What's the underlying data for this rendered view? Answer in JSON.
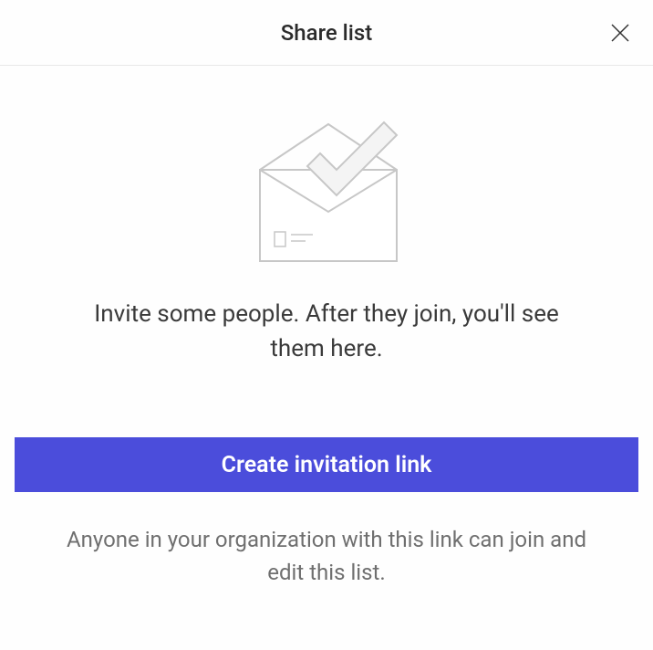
{
  "dialog": {
    "title": "Share list",
    "invite_text": "Invite some people. After they join, you'll see them here.",
    "primary_button_label": "Create invitation link",
    "helper_text": "Anyone in your organization with this link can join and edit this list."
  }
}
